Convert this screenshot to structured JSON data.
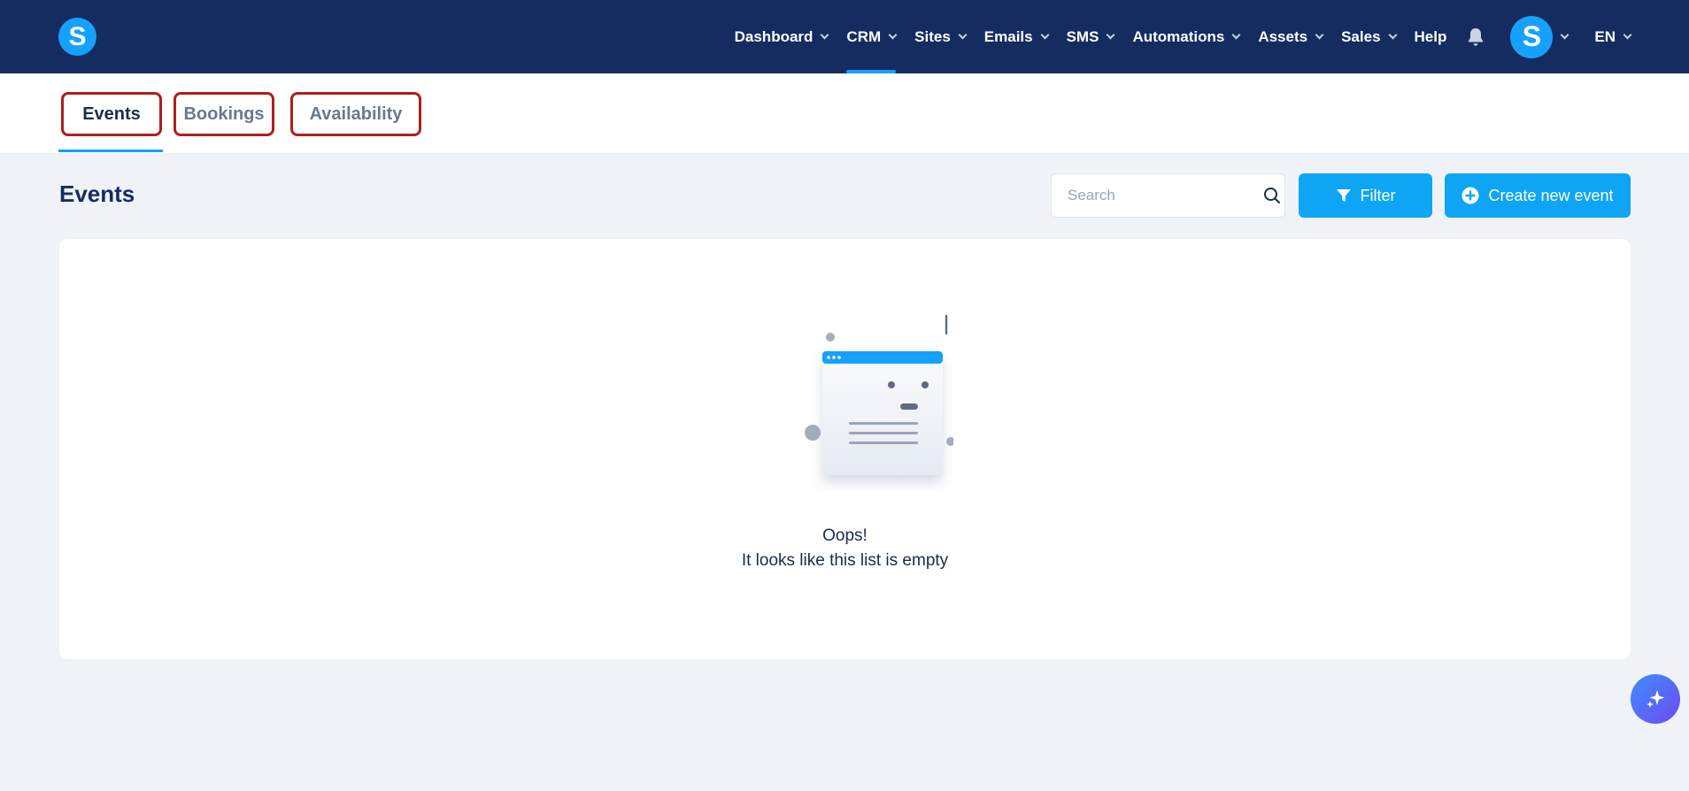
{
  "brand": {
    "logo_letter": "S",
    "accent_color": "#16a0ff",
    "nav_bg": "#152c61"
  },
  "nav": {
    "items": [
      {
        "label": "Dashboard",
        "dropdown": true
      },
      {
        "label": "CRM",
        "dropdown": true,
        "active": true
      },
      {
        "label": "Sites",
        "dropdown": true
      },
      {
        "label": "Emails",
        "dropdown": true
      },
      {
        "label": "SMS",
        "dropdown": true
      },
      {
        "label": "Automations",
        "dropdown": true
      },
      {
        "label": "Assets",
        "dropdown": true
      },
      {
        "label": "Sales",
        "dropdown": true
      },
      {
        "label": "Help",
        "dropdown": false
      }
    ],
    "bell_icon": "bell-icon",
    "avatar_letter": "S",
    "language": "EN"
  },
  "tabs": [
    {
      "label": "Events",
      "active": true
    },
    {
      "label": "Bookings",
      "active": false
    },
    {
      "label": "Availability",
      "active": false
    }
  ],
  "header": {
    "title": "Events",
    "search_placeholder": "Search",
    "filter_label": "Filter",
    "create_label": "Create new event"
  },
  "empty_state": {
    "title": "Oops!",
    "subtitle": "It looks like this list is empty"
  },
  "icons": {
    "search": "search-icon",
    "filter": "filter-icon",
    "create": "plus-circle-icon",
    "ai": "sparkle-icon"
  }
}
